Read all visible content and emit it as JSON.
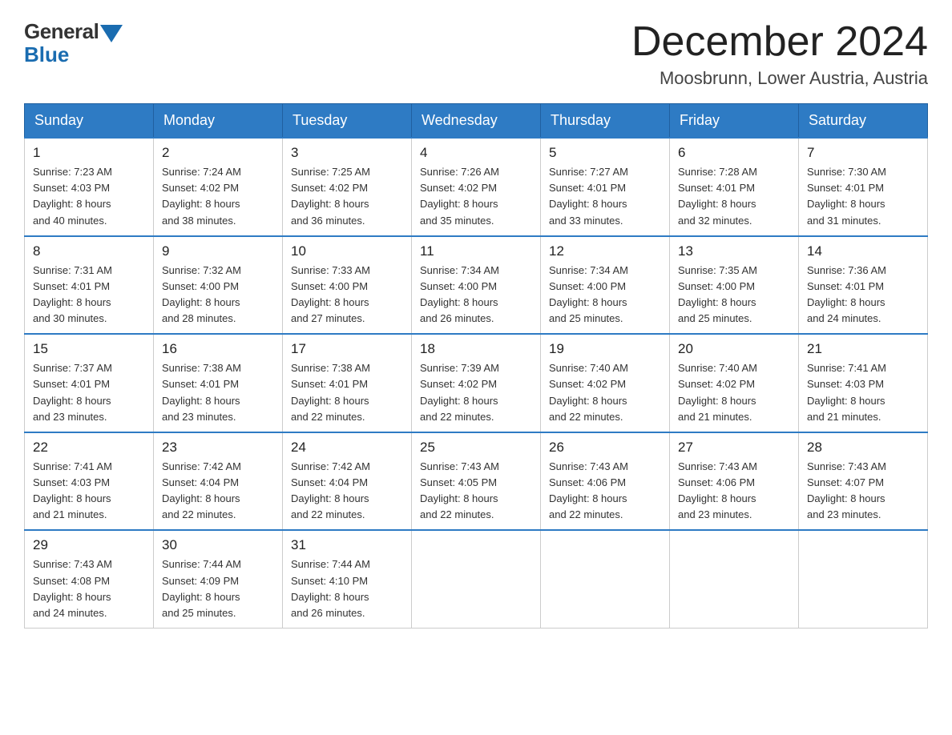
{
  "logo": {
    "general": "General",
    "blue": "Blue"
  },
  "header": {
    "month_year": "December 2024",
    "location": "Moosbrunn, Lower Austria, Austria"
  },
  "weekdays": [
    "Sunday",
    "Monday",
    "Tuesday",
    "Wednesday",
    "Thursday",
    "Friday",
    "Saturday"
  ],
  "weeks": [
    [
      {
        "day": "1",
        "sunrise": "7:23 AM",
        "sunset": "4:03 PM",
        "daylight": "8 hours and 40 minutes."
      },
      {
        "day": "2",
        "sunrise": "7:24 AM",
        "sunset": "4:02 PM",
        "daylight": "8 hours and 38 minutes."
      },
      {
        "day": "3",
        "sunrise": "7:25 AM",
        "sunset": "4:02 PM",
        "daylight": "8 hours and 36 minutes."
      },
      {
        "day": "4",
        "sunrise": "7:26 AM",
        "sunset": "4:02 PM",
        "daylight": "8 hours and 35 minutes."
      },
      {
        "day": "5",
        "sunrise": "7:27 AM",
        "sunset": "4:01 PM",
        "daylight": "8 hours and 33 minutes."
      },
      {
        "day": "6",
        "sunrise": "7:28 AM",
        "sunset": "4:01 PM",
        "daylight": "8 hours and 32 minutes."
      },
      {
        "day": "7",
        "sunrise": "7:30 AM",
        "sunset": "4:01 PM",
        "daylight": "8 hours and 31 minutes."
      }
    ],
    [
      {
        "day": "8",
        "sunrise": "7:31 AM",
        "sunset": "4:01 PM",
        "daylight": "8 hours and 30 minutes."
      },
      {
        "day": "9",
        "sunrise": "7:32 AM",
        "sunset": "4:00 PM",
        "daylight": "8 hours and 28 minutes."
      },
      {
        "day": "10",
        "sunrise": "7:33 AM",
        "sunset": "4:00 PM",
        "daylight": "8 hours and 27 minutes."
      },
      {
        "day": "11",
        "sunrise": "7:34 AM",
        "sunset": "4:00 PM",
        "daylight": "8 hours and 26 minutes."
      },
      {
        "day": "12",
        "sunrise": "7:34 AM",
        "sunset": "4:00 PM",
        "daylight": "8 hours and 25 minutes."
      },
      {
        "day": "13",
        "sunrise": "7:35 AM",
        "sunset": "4:00 PM",
        "daylight": "8 hours and 25 minutes."
      },
      {
        "day": "14",
        "sunrise": "7:36 AM",
        "sunset": "4:01 PM",
        "daylight": "8 hours and 24 minutes."
      }
    ],
    [
      {
        "day": "15",
        "sunrise": "7:37 AM",
        "sunset": "4:01 PM",
        "daylight": "8 hours and 23 minutes."
      },
      {
        "day": "16",
        "sunrise": "7:38 AM",
        "sunset": "4:01 PM",
        "daylight": "8 hours and 23 minutes."
      },
      {
        "day": "17",
        "sunrise": "7:38 AM",
        "sunset": "4:01 PM",
        "daylight": "8 hours and 22 minutes."
      },
      {
        "day": "18",
        "sunrise": "7:39 AM",
        "sunset": "4:02 PM",
        "daylight": "8 hours and 22 minutes."
      },
      {
        "day": "19",
        "sunrise": "7:40 AM",
        "sunset": "4:02 PM",
        "daylight": "8 hours and 22 minutes."
      },
      {
        "day": "20",
        "sunrise": "7:40 AM",
        "sunset": "4:02 PM",
        "daylight": "8 hours and 21 minutes."
      },
      {
        "day": "21",
        "sunrise": "7:41 AM",
        "sunset": "4:03 PM",
        "daylight": "8 hours and 21 minutes."
      }
    ],
    [
      {
        "day": "22",
        "sunrise": "7:41 AM",
        "sunset": "4:03 PM",
        "daylight": "8 hours and 21 minutes."
      },
      {
        "day": "23",
        "sunrise": "7:42 AM",
        "sunset": "4:04 PM",
        "daylight": "8 hours and 22 minutes."
      },
      {
        "day": "24",
        "sunrise": "7:42 AM",
        "sunset": "4:04 PM",
        "daylight": "8 hours and 22 minutes."
      },
      {
        "day": "25",
        "sunrise": "7:43 AM",
        "sunset": "4:05 PM",
        "daylight": "8 hours and 22 minutes."
      },
      {
        "day": "26",
        "sunrise": "7:43 AM",
        "sunset": "4:06 PM",
        "daylight": "8 hours and 22 minutes."
      },
      {
        "day": "27",
        "sunrise": "7:43 AM",
        "sunset": "4:06 PM",
        "daylight": "8 hours and 23 minutes."
      },
      {
        "day": "28",
        "sunrise": "7:43 AM",
        "sunset": "4:07 PM",
        "daylight": "8 hours and 23 minutes."
      }
    ],
    [
      {
        "day": "29",
        "sunrise": "7:43 AM",
        "sunset": "4:08 PM",
        "daylight": "8 hours and 24 minutes."
      },
      {
        "day": "30",
        "sunrise": "7:44 AM",
        "sunset": "4:09 PM",
        "daylight": "8 hours and 25 minutes."
      },
      {
        "day": "31",
        "sunrise": "7:44 AM",
        "sunset": "4:10 PM",
        "daylight": "8 hours and 26 minutes."
      },
      null,
      null,
      null,
      null
    ]
  ],
  "labels": {
    "sunrise": "Sunrise:",
    "sunset": "Sunset:",
    "daylight": "Daylight:"
  }
}
